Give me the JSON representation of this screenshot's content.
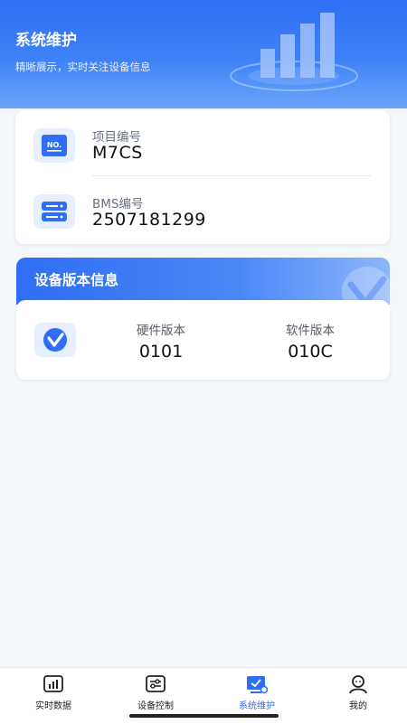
{
  "header": {
    "title": "系统维护",
    "subtitle": "精晰展示，实时关注设备信息"
  },
  "info": {
    "project": {
      "label": "项目编号",
      "value": "M7CS",
      "icon": "no-icon"
    },
    "bms": {
      "label": "BMS编号",
      "value": "2507181299",
      "icon": "server-icon"
    }
  },
  "version": {
    "title": "设备版本信息",
    "hardware_label": "硬件版本",
    "hardware_value": "0101",
    "software_label": "软件版本",
    "software_value": "010C",
    "icon": "brand-v-icon"
  },
  "tabs": [
    {
      "label": "实时数据",
      "icon": "chart-icon"
    },
    {
      "label": "设备控制",
      "icon": "sliders-icon"
    },
    {
      "label": "系统维护",
      "icon": "maintenance-icon",
      "active": true
    },
    {
      "label": "我的",
      "icon": "user-icon"
    }
  ],
  "colors": {
    "primary": "#2f6ef5",
    "background": "#f3f6fb"
  }
}
